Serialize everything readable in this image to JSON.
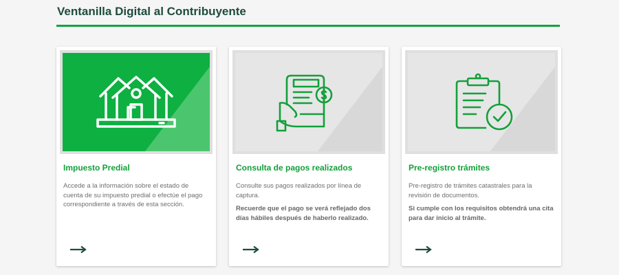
{
  "header": {
    "title": "Ventanilla Digital al Contribuyente"
  },
  "colors": {
    "accent": "#13a33e",
    "title": "#1e4b3e",
    "arrow": "#1e4b3e",
    "card_border": "#dfdfdf"
  },
  "cards": [
    {
      "icon": "houses-icon",
      "title": "Impuesto Predial",
      "text": "Accede a la información sobre el estado de cuenta de su impuesto predial o efectúe el pago correspondiente a través de esta sección.",
      "note": ""
    },
    {
      "icon": "payment-receipt-icon",
      "title": "Consulta de pagos realizados",
      "text": "Consulte sus pagos realizados por línea de captura.",
      "note": "Recuerde que el pago se verá reflejado dos días hábiles después de haberlo realizado."
    },
    {
      "icon": "clipboard-check-icon",
      "title": "Pre-registro trámites",
      "text": "Pre-registro de trámites catastrales para la revisión de documentos.",
      "note": "Si cumple con los requisitos obtendrá una cita para dar inicio al trámite."
    }
  ]
}
